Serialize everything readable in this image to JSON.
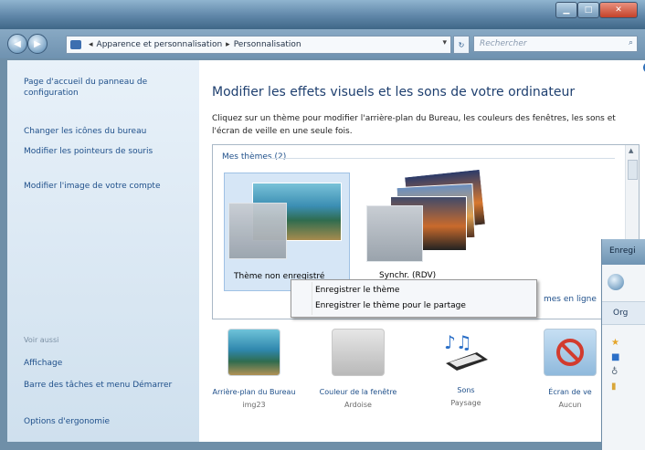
{
  "window": {
    "controls": [
      "minimize-icon",
      "maximize-icon",
      "close-icon"
    ]
  },
  "address_bar": {
    "breadcrumb_1": "Apparence et personnalisation",
    "breadcrumb_2": "Personnalisation",
    "search_placeholder": "Rechercher"
  },
  "sidebar": {
    "home_link": "Page d'accueil du panneau de configuration",
    "links": [
      "Changer les icônes du bureau",
      "Modifier les pointeurs de souris",
      "Modifier l'image de votre compte"
    ],
    "see_also_heading": "Voir aussi",
    "see_also": [
      "Affichage",
      "Barre des tâches et menu Démarrer",
      "Options d'ergonomie"
    ]
  },
  "main": {
    "heading": "Modifier les effets visuels et les sons de votre ordinateur",
    "description": "Cliquez sur un thème pour modifier l'arrière-plan du Bureau, les couleurs des fenêtres, les sons et l'écran de veille en une seule fois.",
    "themes_group_label": "Mes thèmes (2)",
    "themes": [
      {
        "label": "Thème non enregistré",
        "selected": true
      },
      {
        "label": "Synchr. (RDV)",
        "selected": false
      }
    ],
    "more_themes_link": "mes en ligne"
  },
  "context_menu": {
    "items": [
      "Enregistrer le thème",
      "Enregistrer le thème pour le partage"
    ]
  },
  "bottom_items": [
    {
      "title": "Arrière-plan du Bureau",
      "sub": "img23"
    },
    {
      "title": "Couleur de la fenêtre",
      "sub": "Ardoise"
    },
    {
      "title": "Sons",
      "sub": "Paysage"
    },
    {
      "title": "Écran de ve",
      "sub": "Aucun"
    }
  ],
  "overlay_dialog": {
    "title": "Enregi",
    "organize": "Org"
  }
}
